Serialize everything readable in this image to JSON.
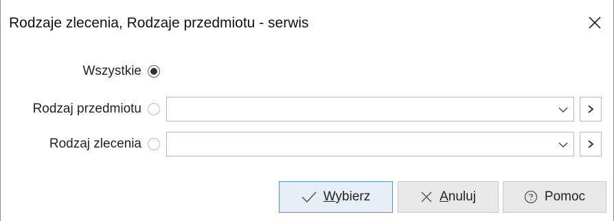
{
  "window": {
    "title": "Rodzaje zlecenia, Rodzaje przedmiotu - serwis",
    "close_icon": "close-icon"
  },
  "options": {
    "all": {
      "label": "Wszystkie",
      "selected": true
    },
    "item_type": {
      "label": "Rodzaj przedmiotu",
      "selected": false,
      "value": ""
    },
    "order_type": {
      "label": "Rodzaj zlecenia",
      "selected": false,
      "value": ""
    }
  },
  "buttons": {
    "select": {
      "label_u": "W",
      "label_rest": "ybierz",
      "icon": "checkmark-icon"
    },
    "cancel": {
      "label_u": "A",
      "label_rest": "nuluj",
      "icon": "close-icon"
    },
    "help": {
      "label": "Pomoc",
      "icon": "help-circle-icon"
    }
  },
  "colors": {
    "primary_border": "#4f95d6",
    "primary_bg": "#e6eef6",
    "button_bg": "#e8e8e8"
  }
}
